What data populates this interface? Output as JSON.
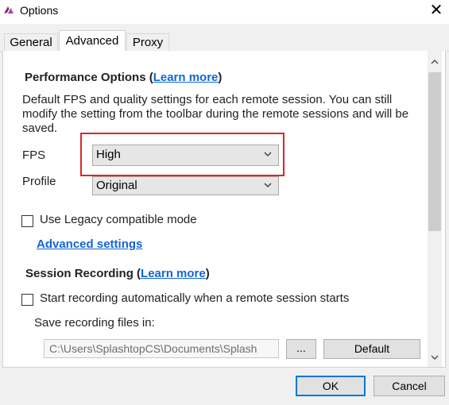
{
  "window": {
    "title": "Options",
    "close_glyph": "✕"
  },
  "tabs": [
    {
      "label": "General",
      "active": false
    },
    {
      "label": "Advanced",
      "active": true
    },
    {
      "label": "Proxy",
      "active": false
    }
  ],
  "performance": {
    "title": "Performance Options (",
    "link": "Learn more",
    "title_end": ")",
    "description": "Default FPS and quality settings for each remote session. You can still modify the setting from the toolbar during the remote sessions and will be saved.",
    "fps_label": "FPS",
    "fps_value": "High",
    "profile_label": "Profile",
    "profile_value": "Original",
    "legacy_label": "Use Legacy compatible mode",
    "legacy_checked": false,
    "advanced_link": "Advanced settings"
  },
  "recording": {
    "title": "Session Recording (",
    "link": "Learn more",
    "title_end": ")",
    "auto_label": "Start recording automatically when a remote session starts",
    "auto_checked": false,
    "save_label": "Save recording files in:",
    "path_value": "C:\\Users\\SplashtopCS\\Documents\\Splash",
    "browse_label": "...",
    "default_label": "Default"
  },
  "footer": {
    "ok_label": "OK",
    "cancel_label": "Cancel"
  },
  "icons": {
    "app": "splashtop-logo-icon",
    "close": "close-icon",
    "chevron": "chevron-down-icon",
    "scroll_up": "scroll-up-arrow-icon",
    "scroll_down": "scroll-down-arrow-icon"
  },
  "colors": {
    "link": "#1366d6",
    "highlight": "#d9262a",
    "ok_border": "#0078d7"
  }
}
